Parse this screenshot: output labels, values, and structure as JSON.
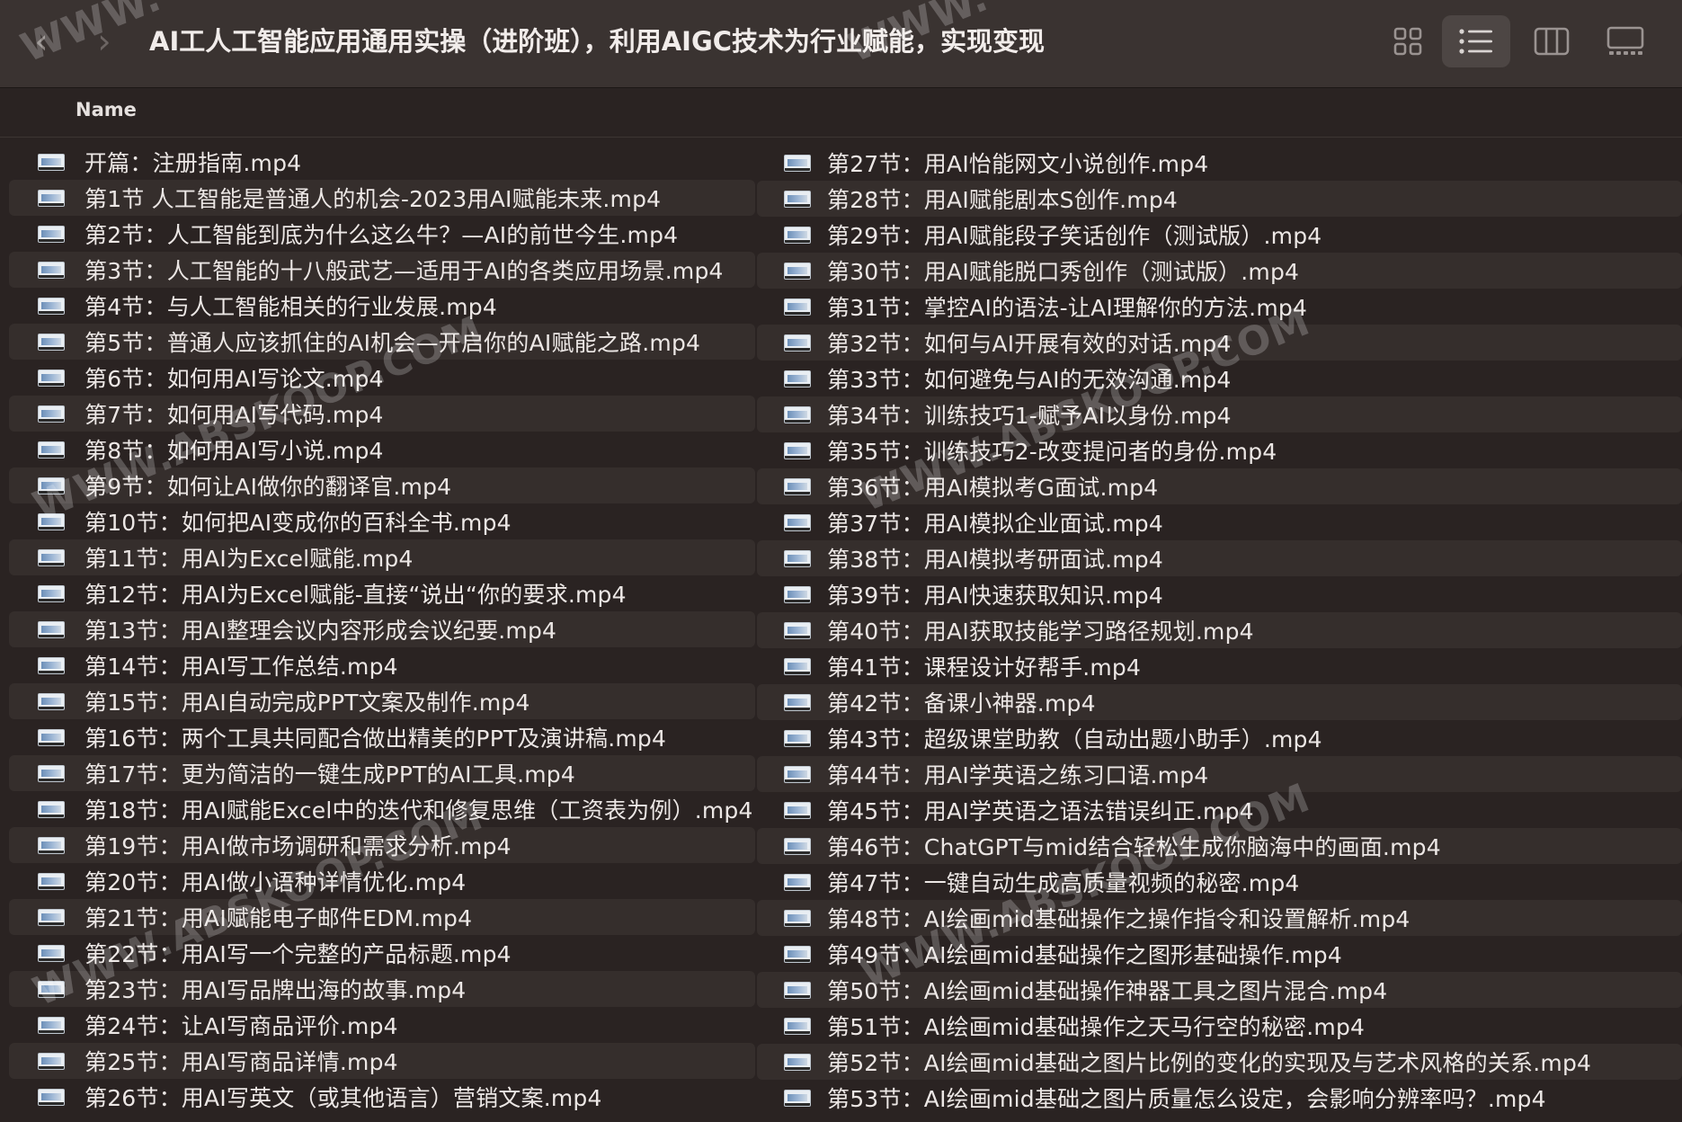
{
  "window": {
    "title": "AI工人工智能应用通用实操（进阶班），利用AIGC技术为行业赋能，实现变现",
    "back_icon": "‹",
    "forward_icon": "›"
  },
  "view_buttons": [
    {
      "name": "icon-view-icon",
      "active": false
    },
    {
      "name": "list-view-icon",
      "active": true
    },
    {
      "name": "column-view-icon",
      "active": false
    },
    {
      "name": "gallery-view-icon",
      "active": false
    }
  ],
  "header": {
    "name": "Name"
  },
  "files_left": [
    "开篇：注册指南.mp4",
    "第1节 人工智能是普通人的机会-2023用AI赋能未来.mp4",
    "第2节：人工智能到底为什么这么牛？—AI的前世今生.mp4",
    "第3节：人工智能的十八般武艺—适用于AI的各类应用场景.mp4",
    "第4节：与人工智能相关的行业发展.mp4",
    "第5节：普通人应该抓住的AI机会—开启你的AI赋能之路.mp4",
    "第6节：如何用AI写论文.mp4",
    "第7节：如何用AI写代码.mp4",
    "第8节：如何用AI写小说.mp4",
    "第9节：如何让AI做你的翻译官.mp4",
    "第10节：如何把AI变成你的百科全书.mp4",
    "第11节：用AI为Excel赋能.mp4",
    "第12节：用AI为Excel赋能-直接“说出“你的要求.mp4",
    "第13节：用AI整理会议内容形成会议纪要.mp4",
    "第14节：用AI写工作总结.mp4",
    "第15节：用AI自动完成PPT文案及制作.mp4",
    "第16节：两个工具共同配合做出精美的PPT及演讲稿.mp4",
    "第17节：更为简洁的一键生成PPT的AI工具.mp4",
    "第18节：用AI赋能Excel中的迭代和修复思维（工资表为例）.mp4",
    "第19节：用AI做市场调研和需求分析.mp4",
    "第20节：用AI做小语种详情优化.mp4",
    "第21节：用AI赋能电子邮件EDM.mp4",
    "第22节：用AI写一个完整的产品标题.mp4",
    "第23节：用AI写品牌出海的故事.mp4",
    "第24节：让AI写商品评价.mp4",
    "第25节：用AI写商品详情.mp4",
    "第26节：用AI写英文（或其他语言）营销文案.mp4"
  ],
  "files_right": [
    "第27节：用AI怡能网文小说创作.mp4",
    "第28节：用AI赋能剧本S创作.mp4",
    "第29节：用AI赋能段子笑话创作（测试版）.mp4",
    "第30节：用AI赋能脱口秀创作（测试版）.mp4",
    "第31节：掌控AI的语法-让AI理解你的方法.mp4",
    "第32节：如何与AI开展有效的对话.mp4",
    "第33节：如何避免与AI的无效沟通.mp4",
    "第34节：训练技巧1-赋予AI以身份.mp4",
    "第35节：训练技巧2-改变提问者的身份.mp4",
    "第36节：用AI模拟考G面试.mp4",
    "第37节：用AI模拟企业面试.mp4",
    "第38节：用AI模拟考研面试.mp4",
    "第39节：用AI快速获取知识.mp4",
    "第40节：用AI获取技能学习路径规划.mp4",
    "第41节：课程设计好帮手.mp4",
    "第42节：备课小神器.mp4",
    "第43节：超级课堂助教（自动出题小助手）.mp4",
    "第44节：用AI学英语之练习口语.mp4",
    "第45节：用AI学英语之语法错误纠正.mp4",
    "第46节：ChatGPT与mid结合轻松生成你脑海中的画面.mp4",
    "第47节：一键自动生成高质量视频的秘密.mp4",
    "第48节：AI绘画mid基础操作之操作指令和设置解析.mp4",
    "第49节：AI绘画mid基础操作之图形基础操作.mp4",
    "第50节：AI绘画mid基础操作神器工具之图片混合.mp4",
    "第51节：AI绘画mid基础操作之天马行空的秘密.mp4",
    "第52节：AI绘画mid基础之图片比例的变化的实现及与艺术风格的关系.mp4",
    "第53节：AI绘画mid基础之图片质量怎么设定，会影响分辨率吗？.mp4"
  ],
  "watermarks": [
    "WWW.ABSKOOP.COM",
    "WWW.ABSKOOP.COM",
    "WWW.ABSKOOP.COM",
    "WWW.ABSKOOP.COM",
    "WWW.",
    "WWW."
  ]
}
